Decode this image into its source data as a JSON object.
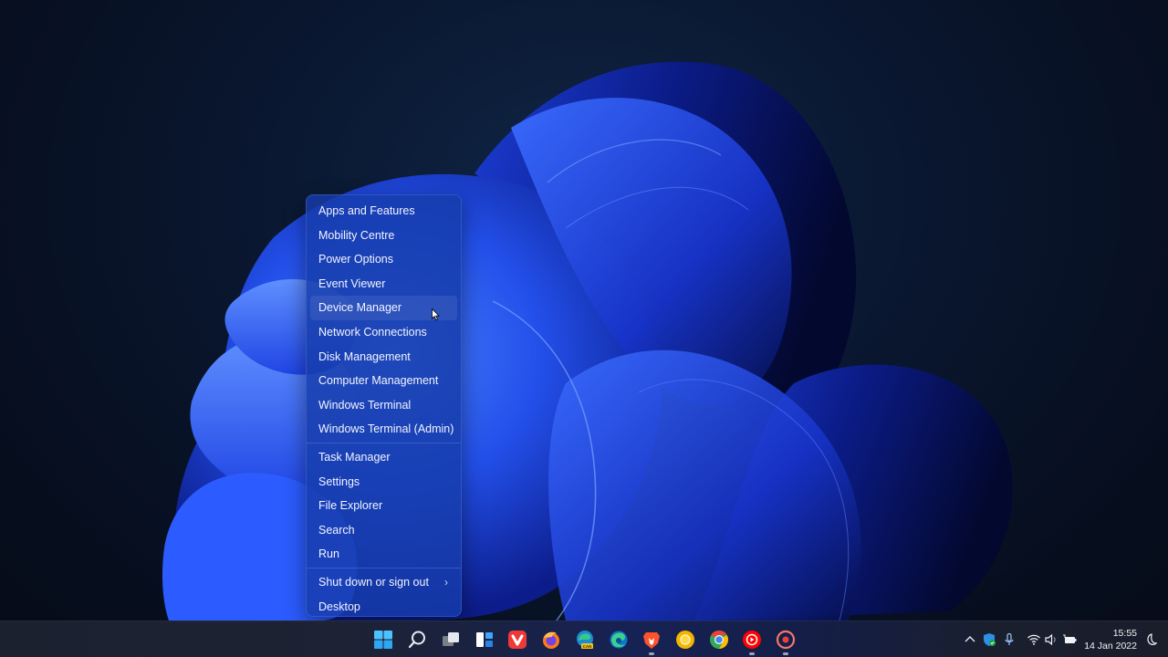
{
  "desktop": {
    "wallpaper": "Windows 11 Bloom (dark, blue)",
    "colors": {
      "background_dark": "#070f20",
      "bloom_light": "#3a6cff",
      "bloom_mid": "#1f48e0",
      "bloom_deep": "#0a1a7a"
    }
  },
  "context_menu": {
    "groups": [
      [
        {
          "label": "Apps and Features"
        },
        {
          "label": "Mobility Centre"
        },
        {
          "label": "Power Options"
        },
        {
          "label": "Event Viewer"
        },
        {
          "label": "Device Manager",
          "hovered": true
        },
        {
          "label": "Network Connections"
        },
        {
          "label": "Disk Management"
        },
        {
          "label": "Computer Management"
        },
        {
          "label": "Windows Terminal"
        },
        {
          "label": "Windows Terminal (Admin)"
        }
      ],
      [
        {
          "label": "Task Manager"
        },
        {
          "label": "Settings"
        },
        {
          "label": "File Explorer"
        },
        {
          "label": "Search"
        },
        {
          "label": "Run"
        }
      ],
      [
        {
          "label": "Shut down or sign out",
          "submenu": true,
          "chevron": "›"
        },
        {
          "label": "Desktop"
        }
      ]
    ],
    "colors": {
      "background": "#163caa",
      "text": "#f2f5ff"
    }
  },
  "taskbar": {
    "apps": [
      {
        "name": "start",
        "icon": "windows-logo-icon",
        "running": false
      },
      {
        "name": "search",
        "icon": "search-icon",
        "running": false
      },
      {
        "name": "task-view",
        "icon": "task-view-icon",
        "running": false
      },
      {
        "name": "widgets",
        "icon": "widgets-icon",
        "running": false
      },
      {
        "name": "vivaldi",
        "icon": "vivaldi-icon",
        "running": false
      },
      {
        "name": "firefox",
        "icon": "firefox-icon",
        "running": false
      },
      {
        "name": "edge-canary",
        "icon": "edge-canary-icon",
        "badge": "CAN",
        "running": false
      },
      {
        "name": "edge",
        "icon": "edge-icon",
        "running": false
      },
      {
        "name": "brave",
        "icon": "brave-icon",
        "running": true
      },
      {
        "name": "chrome-canary",
        "icon": "chrome-canary-icon",
        "running": false
      },
      {
        "name": "chrome",
        "icon": "chrome-icon",
        "running": false
      },
      {
        "name": "youtube-music",
        "icon": "youtube-music-icon",
        "running": true
      },
      {
        "name": "screen-recorder",
        "icon": "record-icon",
        "running": true
      }
    ],
    "tray": {
      "icons": [
        "chevron-up-icon",
        "windows-security-icon",
        "microphone-icon",
        "wifi-icon",
        "volume-icon",
        "battery-charging-icon"
      ],
      "time": "15:55",
      "date": "14 Jan 2022",
      "focus_icon": "moon-icon"
    }
  }
}
